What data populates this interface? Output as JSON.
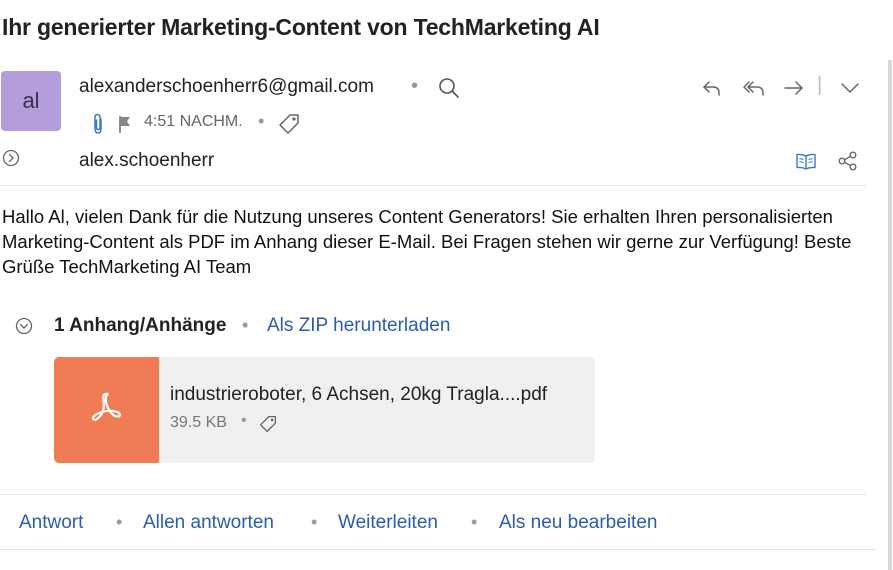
{
  "email": {
    "subject": "Ihr generierter Marketing-Content von TechMarketing AI",
    "avatar_initials": "al",
    "avatar_color": "#b39ddb",
    "sender": "alexanderschoenherr6@gmail.com",
    "time": "4:51 NACHM.",
    "recipient": "alex.schoenherr",
    "body": "Hallo Al, vielen Dank für die Nutzung unseres Content Generators! Sie erhalten Ihren personalisierten Marketing-Content als PDF im Anhang dieser E-Mail. Bei Fragen stehen wir gerne zur Verfügung! Beste Grüße TechMarketing AI Team"
  },
  "separator": "•",
  "toolbar_separator": "|",
  "icons": {
    "search": "search-icon",
    "attachment": "paperclip-icon",
    "flag": "flag-icon",
    "tag": "tag-icon",
    "reply": "reply-icon",
    "reply_all": "reply-all-icon",
    "forward": "forward-icon",
    "more": "chevron-down-icon",
    "expand": "expand-circle-icon",
    "reader": "book-icon",
    "share": "share-icon",
    "pdf": "pdf-icon"
  },
  "attachments": {
    "header": "1 Anhang/Anhänge",
    "zip_link": "Als ZIP herunterladen",
    "items": [
      {
        "name": "industrieroboter, 6 Achsen, 20kg Tragla....pdf",
        "size": "39.5 KB",
        "thumb_color": "#f07c55"
      }
    ]
  },
  "actions": {
    "reply": "Antwort",
    "reply_all": "Allen antworten",
    "forward": "Weiterleiten",
    "edit_as_new": "Als neu bearbeiten"
  },
  "colors": {
    "link": "#2a5db0",
    "muted": "#999999"
  }
}
